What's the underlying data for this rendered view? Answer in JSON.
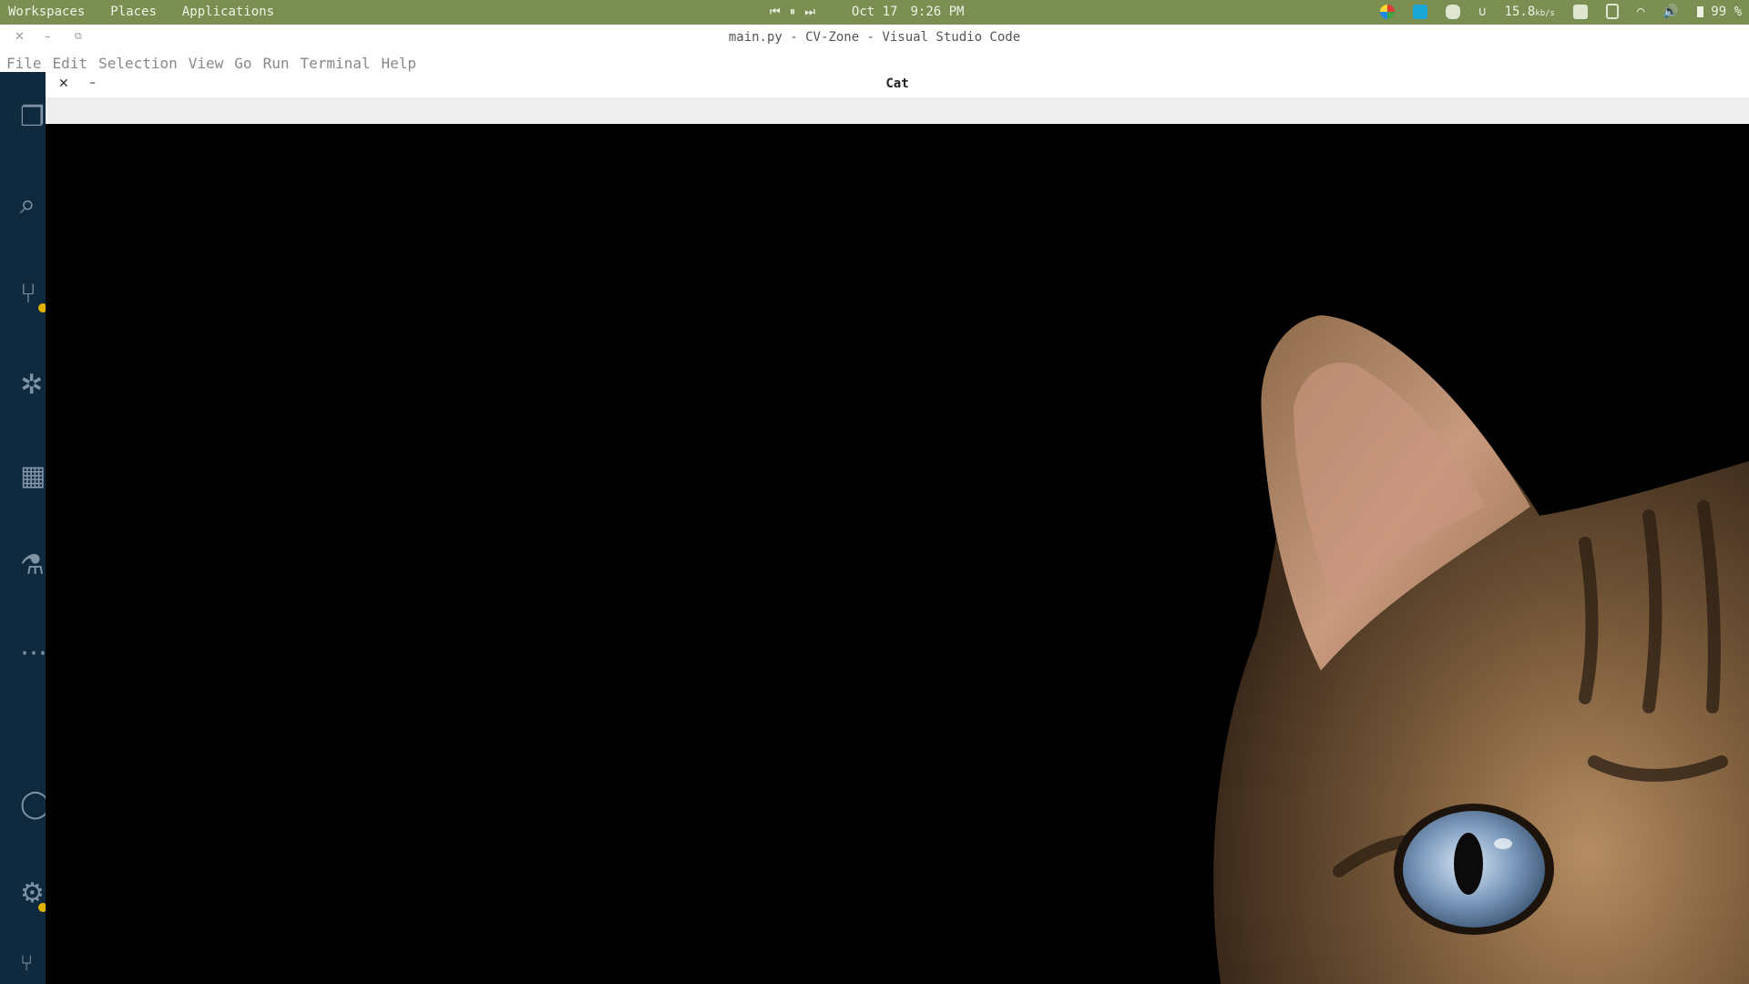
{
  "topbar": {
    "workspaces": "Workspaces",
    "places": "Places",
    "applications": "Applications",
    "date": "Oct 17",
    "time": "9:26 PM",
    "net_speed": "15.8",
    "net_unit": "kb/s",
    "battery": "99 %",
    "icons": [
      "media-prev-icon",
      "media-pause-icon",
      "media-next-icon",
      "colorful-app-icon",
      "chat-app-icon",
      "discord-icon",
      "magnet-icon",
      "display-icon",
      "clipboard-icon",
      "wifi-icon",
      "volume-icon",
      "battery-icon"
    ]
  },
  "vscode": {
    "window_title": "main.py - CV-Zone - Visual Studio Code",
    "menu": [
      "File",
      "Edit",
      "Selection",
      "View",
      "Go",
      "Run",
      "Terminal",
      "Help"
    ],
    "activity_icons": [
      "explorer-icon",
      "search-icon",
      "source-control-icon",
      "run-debug-icon",
      "extensions-icon",
      "testing-icon",
      "more-icon",
      "account-icon",
      "settings-icon"
    ]
  },
  "image_window": {
    "title": "Cat",
    "close": "✕",
    "minimize": "–"
  },
  "colors": {
    "topbar_bg": "#7b8f52",
    "activity_bg": "#0f2a3f",
    "badge": "#e1b200"
  }
}
